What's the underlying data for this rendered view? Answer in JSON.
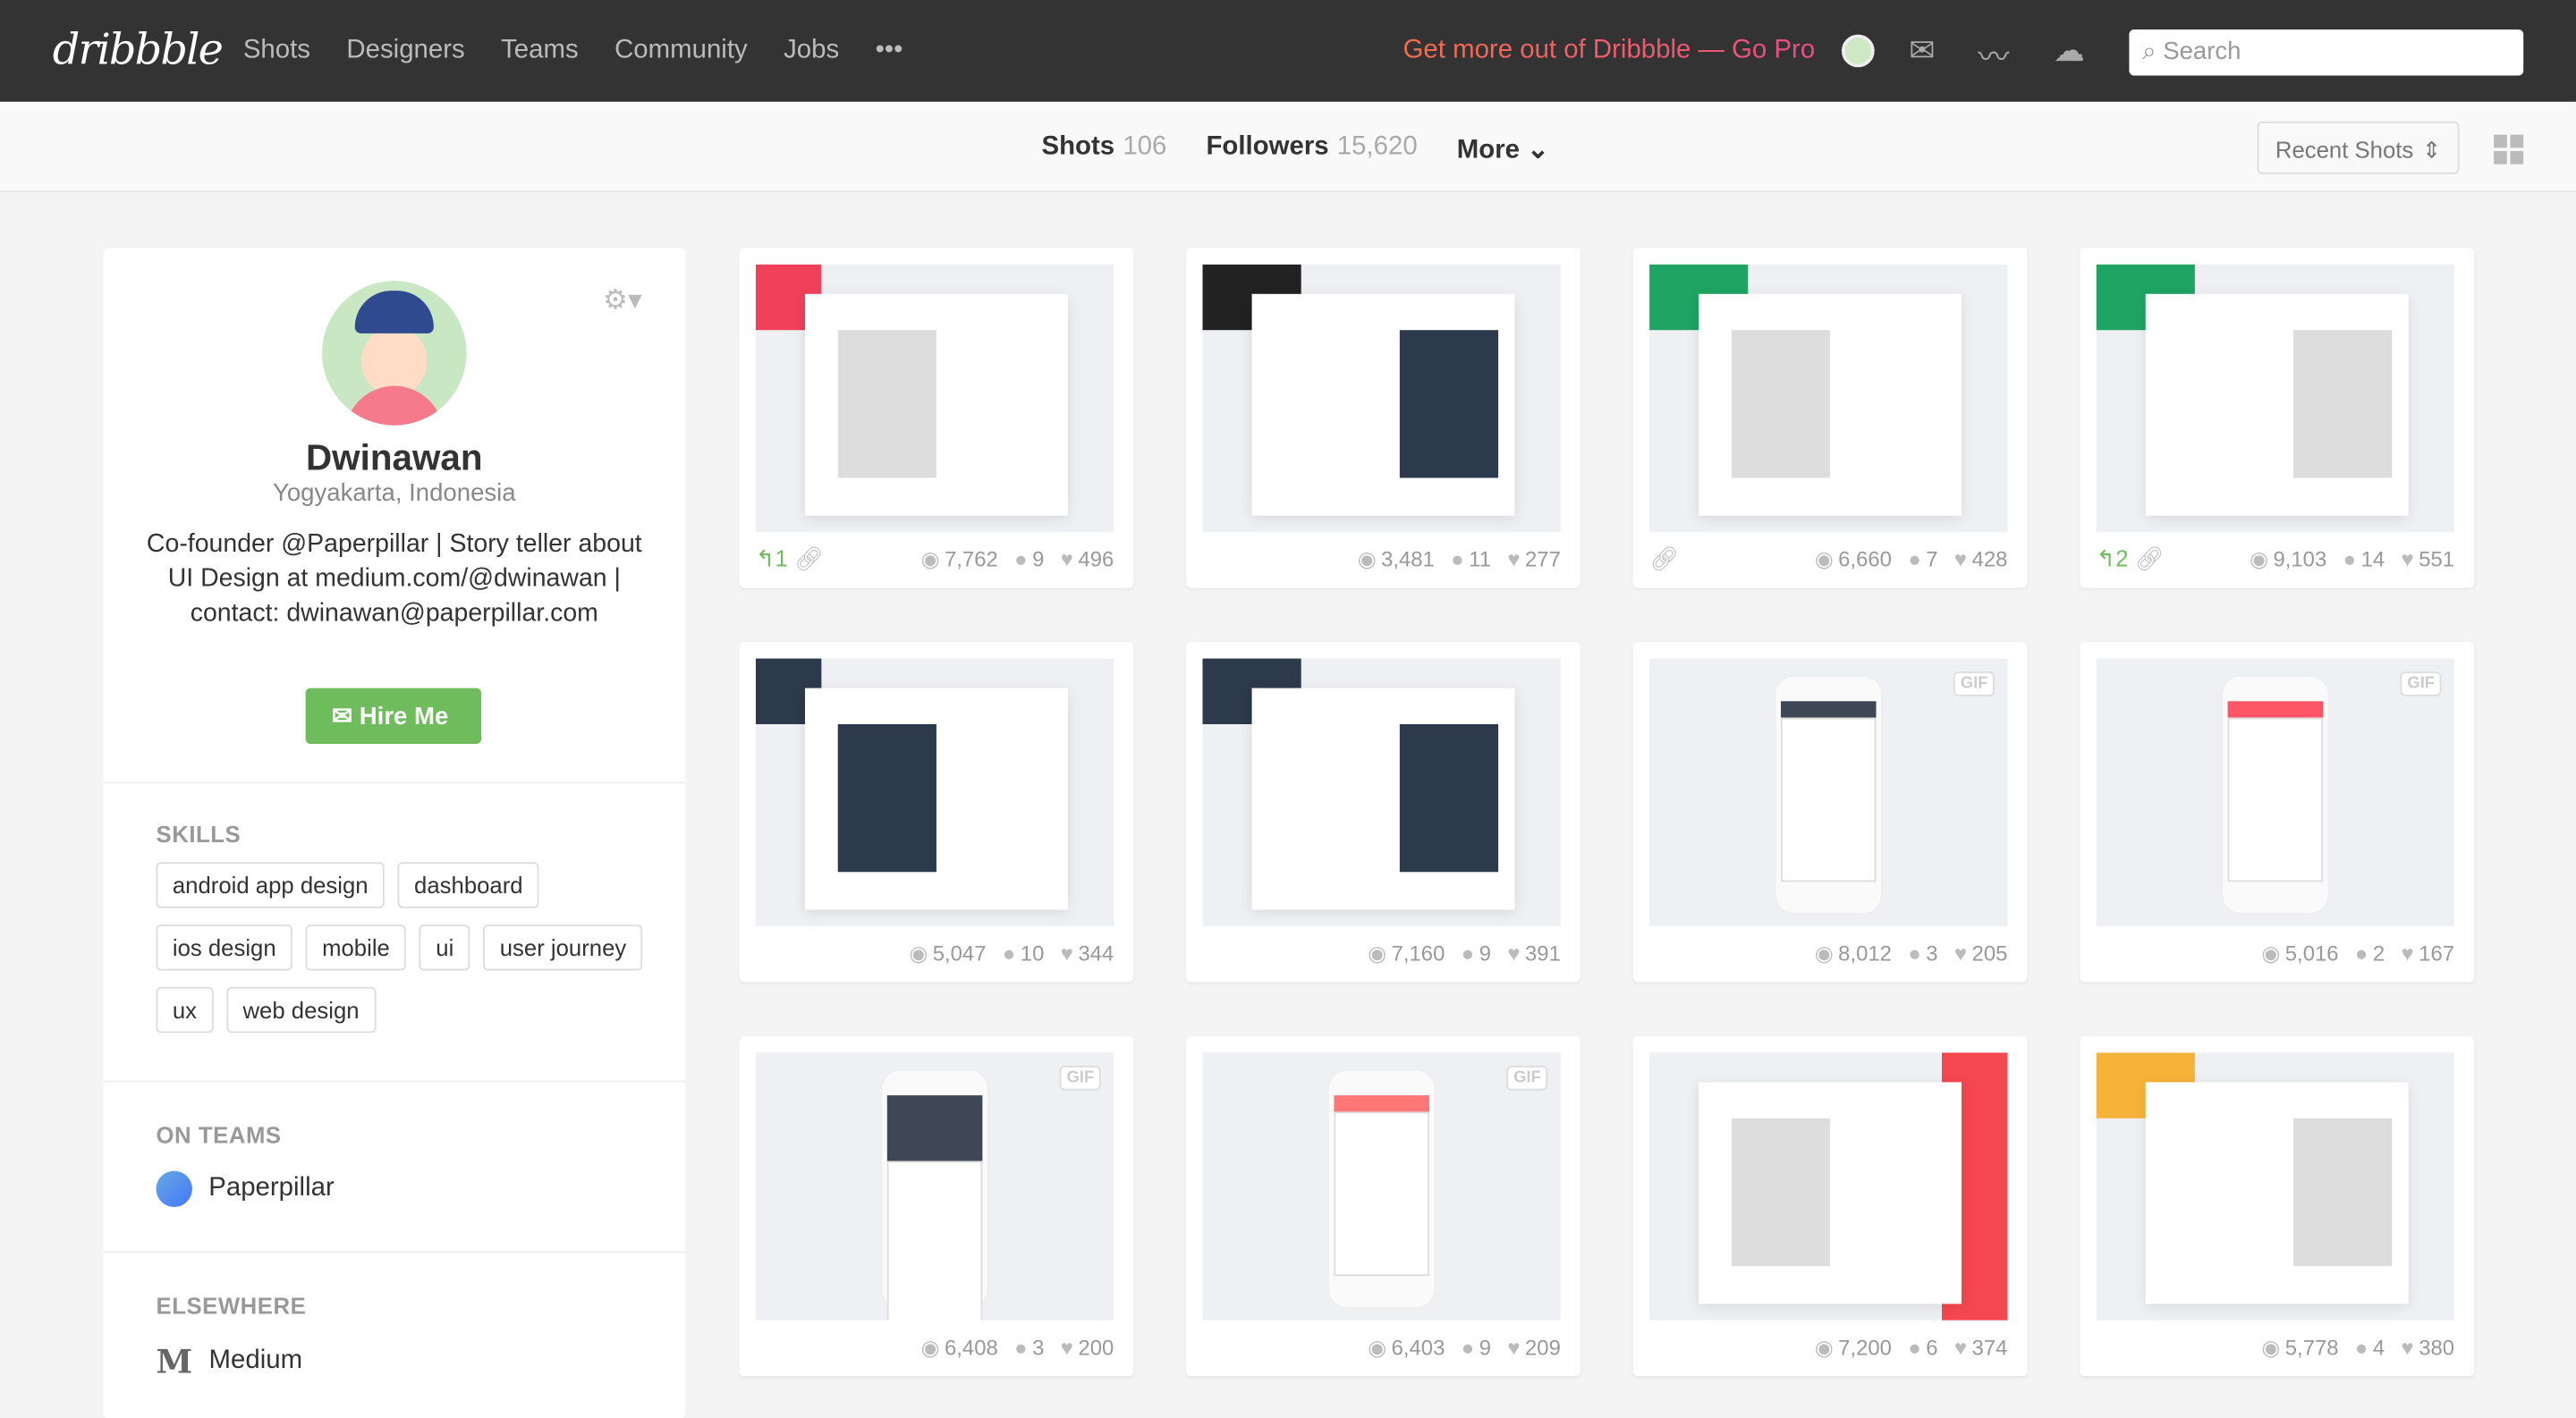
{
  "header": {
    "logo": "dribbble",
    "nav": [
      "Shots",
      "Designers",
      "Teams",
      "Community",
      "Jobs",
      "•••"
    ],
    "promo": "Get more out of Dribbble — Go Pro",
    "search_placeholder": "Search"
  },
  "subnav": {
    "shots_label": "Shots",
    "shots_count": "106",
    "followers_label": "Followers",
    "followers_count": "15,620",
    "more_label": "More ⌄",
    "sort": "Recent Shots"
  },
  "profile": {
    "name": "Dwinawan",
    "location": "Yogyakarta, Indonesia",
    "bio": "Co-founder @Paperpillar | Story teller about UI Design at medium.com/@dwinawan | contact: dwinawan@paperpillar.com",
    "hire": "Hire Me",
    "skills_heading": "SKILLS",
    "skills": [
      "android app design",
      "dashboard",
      "ios design",
      "mobile",
      "ui",
      "user journey",
      "ux",
      "web design"
    ],
    "teams_heading": "ON TEAMS",
    "team": "Paperpillar",
    "elsewhere_heading": "ELSEWHERE",
    "elsewhere": "Medium"
  },
  "shots": [
    {
      "views": "7,762",
      "comments": "9",
      "likes": "496",
      "rebounds": "1",
      "attachment": true,
      "gif": false,
      "accent": "#f0405a"
    },
    {
      "views": "3,481",
      "comments": "11",
      "likes": "277",
      "gif": false,
      "accent": "#222"
    },
    {
      "views": "6,660",
      "comments": "7",
      "likes": "428",
      "attachment": true,
      "gif": false,
      "accent": "#1fa463"
    },
    {
      "views": "9,103",
      "comments": "14",
      "likes": "551",
      "rebounds": "2",
      "attachment": true,
      "gif": false,
      "accent": "#1fa463"
    },
    {
      "views": "5,047",
      "comments": "10",
      "likes": "344",
      "gif": false,
      "accent": "#2d3a4b"
    },
    {
      "views": "7,160",
      "comments": "9",
      "likes": "391",
      "gif": false,
      "accent": "#2d3a4b"
    },
    {
      "views": "8,012",
      "comments": "3",
      "likes": "205",
      "gif": true,
      "accent": "#3d4756"
    },
    {
      "views": "5,016",
      "comments": "2",
      "likes": "167",
      "gif": true,
      "accent": "#f56"
    },
    {
      "views": "6,408",
      "comments": "3",
      "likes": "200",
      "gif": true,
      "accent": "#3d4756"
    },
    {
      "views": "6,403",
      "comments": "9",
      "likes": "209",
      "gif": true,
      "accent": "#f77"
    },
    {
      "views": "7,200",
      "comments": "6",
      "likes": "374",
      "gif": false,
      "accent": "#f5474f"
    },
    {
      "views": "5,778",
      "comments": "4",
      "likes": "380",
      "gif": false,
      "accent": "#f6b33a"
    }
  ],
  "gif_label": "GIF"
}
